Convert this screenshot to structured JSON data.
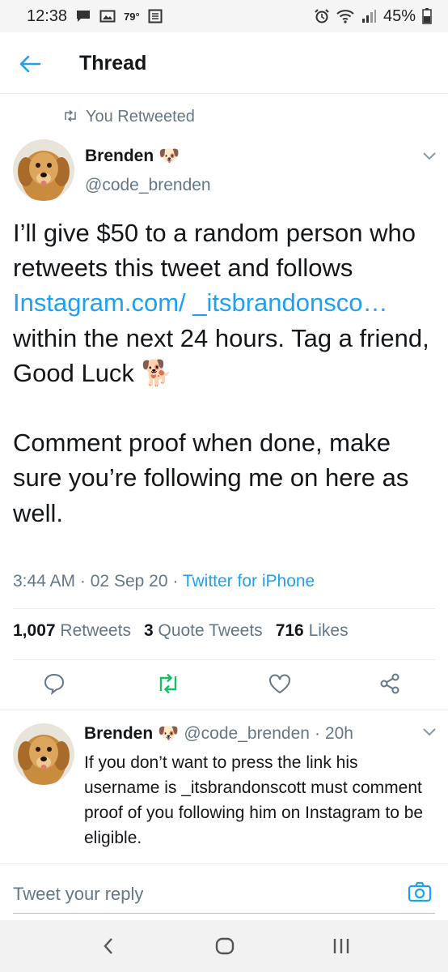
{
  "status_bar": {
    "time": "12:38",
    "temperature": "79°",
    "battery": "45%",
    "icons": [
      "message-icon",
      "image-icon",
      "weather-icon",
      "news-icon",
      "alarm-icon",
      "wifi-icon",
      "signal-icon",
      "battery-icon"
    ]
  },
  "header": {
    "back_icon": "arrow-left-icon",
    "title": "Thread"
  },
  "tweet": {
    "retweeted_label": "You Retweeted",
    "author_name": "Brenden",
    "author_emoji": "🐶",
    "author_handle": "@code_brenden",
    "text_part1": "I’ll give $50 to a random person who retweets this tweet and follows ",
    "link_text": "Instagram.com/ _itsbrandonsco…",
    "text_part2": " within the next 24 hours. Tag a friend, Good Luck ",
    "text_emoji": "🐕",
    "text_para2": "Comment proof when done, make sure you’re following me on here as well.",
    "time": "3:44 AM",
    "date": "02 Sep 20",
    "source": "Twitter for iPhone",
    "separator": "·",
    "retweets_count": "1,007",
    "retweets_label": "Retweets",
    "quotes_count": "3",
    "quotes_label": "Quote Tweets",
    "likes_count": "716",
    "likes_label": "Likes"
  },
  "reply": {
    "author_name": "Brenden",
    "author_emoji": "🐶",
    "author_handle": "@code_brenden",
    "separator": "·",
    "age": "20h",
    "text": "If you don’t want to press the link his username is _itsbrandonscott must comment proof of you following him on Instagram to be eligible."
  },
  "composer": {
    "placeholder": "Tweet your reply"
  },
  "colors": {
    "accent": "#1da1f2",
    "secondary_text": "#657786",
    "retweet_active": "#17bf63"
  }
}
